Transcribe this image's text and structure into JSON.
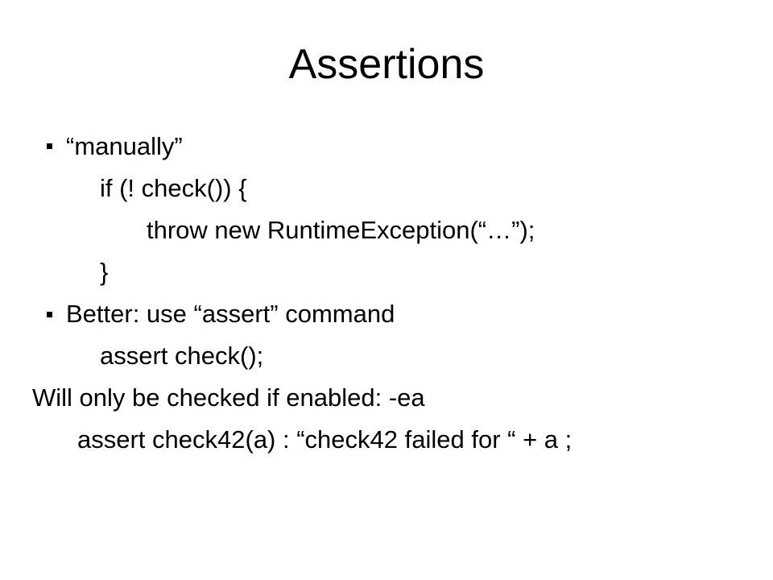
{
  "slide": {
    "title": "Assertions",
    "bullet1": "“manually”",
    "line_if": "if (! check()) {",
    "line_throw": "throw new RuntimeException(“…”);",
    "line_close": "}",
    "bullet2": "Better: use “assert” command",
    "line_assert1": "assert check();",
    "line_willonly": "Will only be checked if enabled:   -ea",
    "line_assert2": "assert check42(a) : “check42 failed for “ + a ;"
  }
}
